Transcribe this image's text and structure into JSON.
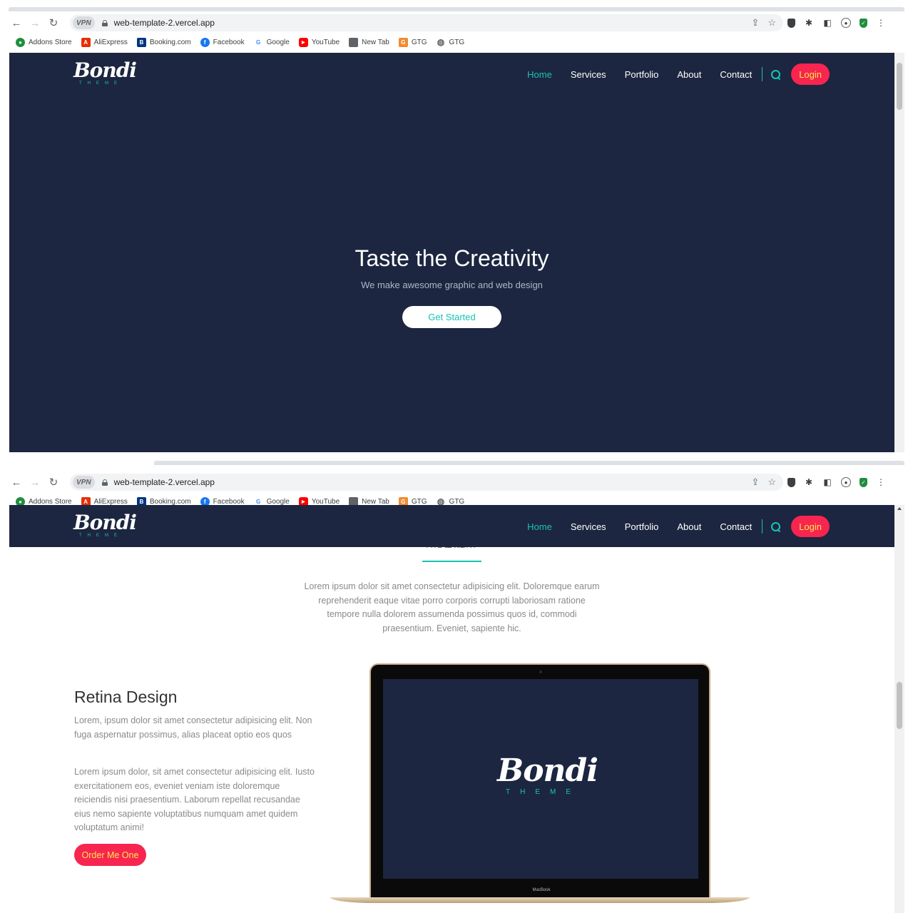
{
  "browser": {
    "vpn_label": "VPN",
    "url": "web-template-2.vercel.app",
    "bookmarks": [
      {
        "label": "Addons Store",
        "icon": "addons-store-icon",
        "color": "#1e8e3e",
        "glyph": "●"
      },
      {
        "label": "AliExpress",
        "icon": "aliexpress-icon",
        "color": "#e62e04",
        "glyph": "A"
      },
      {
        "label": "Booking.com",
        "icon": "booking-icon",
        "color": "#003580",
        "glyph": "B"
      },
      {
        "label": "Facebook",
        "icon": "facebook-icon",
        "color": "#1877f2",
        "glyph": "f"
      },
      {
        "label": "Google",
        "icon": "google-icon",
        "color": "#ffffff",
        "glyph": "G"
      },
      {
        "label": "YouTube",
        "icon": "youtube-icon",
        "color": "#ff0000",
        "glyph": "▶"
      },
      {
        "label": "New Tab",
        "icon": "new-tab-icon",
        "color": "#5f6368",
        "glyph": ""
      },
      {
        "label": "GTG",
        "icon": "gtg-icon",
        "color": "#f28b30",
        "glyph": "G"
      },
      {
        "label": "GTG",
        "icon": "globe-icon",
        "color": "#5f6368",
        "glyph": "◍"
      }
    ]
  },
  "site": {
    "logo_word": "Bondi",
    "logo_sub": "THEME",
    "nav": [
      "Home",
      "Services",
      "Portfolio",
      "About",
      "Contact"
    ],
    "active_nav": "Home",
    "login_label": "Login",
    "accent_color": "#19c3b3",
    "brand_red": "#f7254f",
    "navy": "#1c2640"
  },
  "hero": {
    "title": "Taste the Creativity",
    "subtitle": "We make awesome graphic and web design",
    "cta": "Get Started"
  },
  "section": {
    "intro": "Lorem ipsum dolor sit amet consectetur adipisicing elit. Doloremque earum reprehenderit eaque vitae porro corporis corrupti laboriosam ratione tempore nulla dolorem assumenda possimus quos id, commodi praesentium. Eveniet, sapiente hic.",
    "feature_title": "Retina Design",
    "feature_p1": "Lorem, ipsum dolor sit amet consectetur adipisicing elit. Non fuga aspernatur possimus, alias placeat optio eos quos",
    "feature_p2": "Lorem ipsum dolor, sit amet consectetur adipisicing elit. Iusto exercitationem eos, eveniet veniam iste doloremque reiciendis nisi praesentium. Laborum repellat recusandae eius nemo sapiente voluptatibus numquam amet quidem voluptatum animi!",
    "order_label": "Order Me One",
    "laptop_label": "MacBook"
  }
}
